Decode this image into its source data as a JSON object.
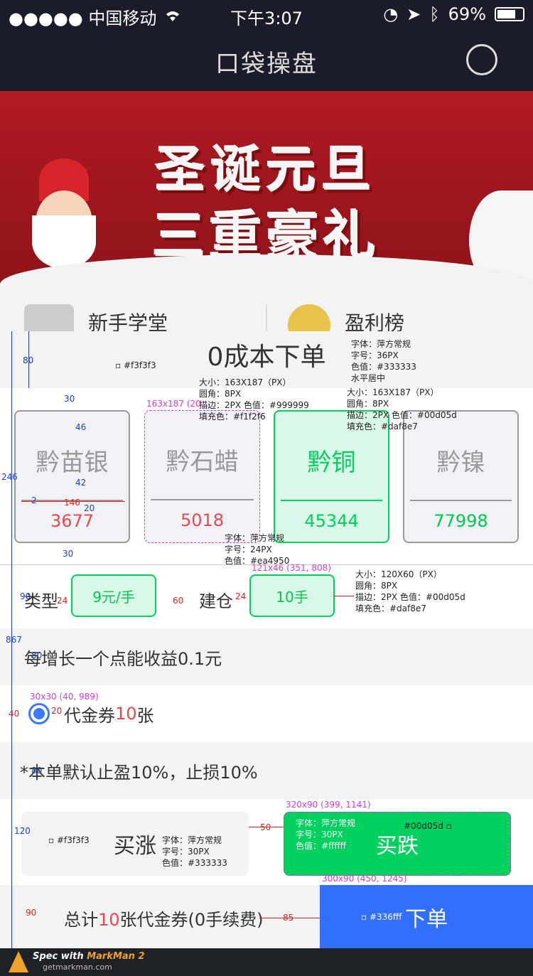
{
  "status_bar": {
    "carrier": "●●●●● 中国移动",
    "time": "下午3:07",
    "battery": "69%"
  },
  "nav": {
    "title": "口袋操盘"
  },
  "banner": {
    "line1": "圣诞元旦",
    "line2": "三重豪礼"
  },
  "quick_links": [
    {
      "label": "新手学堂"
    },
    {
      "label": "盈利榜"
    }
  ],
  "section_title": "0成本下单",
  "products": [
    {
      "name": "黔苗银",
      "price": "3677"
    },
    {
      "name": "黔石蜡",
      "price": "5018"
    },
    {
      "name": "黔铜",
      "price": "45344"
    },
    {
      "name": "黔镍",
      "price": "77998"
    }
  ],
  "type_row": {
    "type_label": "类型",
    "type_value": "9元/手",
    "build_label": "建仓",
    "build_value": "10手"
  },
  "gain_text": "每增长一个点能收益0.1元",
  "voucher": {
    "prefix": "代金券",
    "count": "10",
    "suffix": "张"
  },
  "stop_text": "*本单默认止盈10%，止损10%",
  "buttons": {
    "up": "买涨",
    "down": "买跌",
    "order": "下单"
  },
  "total": {
    "prefix": "总计",
    "count": "10",
    "suffix": "张代金券(0手续费)"
  },
  "annotations": {
    "bg_f3": "#f3f3f3",
    "title_spec": [
      "字体：萍方常规",
      "字号：36PX",
      "色值：#333333",
      "水平居中"
    ],
    "card_spec": [
      "大小：163X187（PX）",
      "圆角：8PX",
      "描边：2PX 色值：#999999",
      "填充色：#f1f2f6"
    ],
    "card_active_spec": [
      "大小：163X187（PX）",
      "圆角：8PX",
      "描边：2PX 色值：#00d05d",
      "填充色：#daf8e7"
    ],
    "card_dim": "163x187 (20…",
    "price_spec": [
      "字体：萍方常规",
      "字号：24PX",
      "色值：#ea4950"
    ],
    "pill_dim": "121x46 (351, 808)",
    "pill_spec": [
      "大小：120X60（PX）",
      "圆角：8PX",
      "描边：2PX 色值：#00d05d",
      "填充色：#daf8e7"
    ],
    "radio_dim": "30x30 (40, 989)",
    "up_spec": [
      "字体：萍方常规",
      "字号：30PX",
      "色值：#333333"
    ],
    "down_dim": "320x90 (399, 1141)",
    "down_spec": [
      "字体：萍方常规",
      "字号：30PX",
      "色值：#ffffff"
    ],
    "down_color": "#00d05d",
    "order_dim": "300x90 (450, 1245)",
    "order_color": "#336fff",
    "dims": {
      "a80": "80",
      "a30": "30",
      "a46": "46",
      "a42": "42",
      "a146": "146",
      "a20": "20",
      "a2": "2",
      "a246": "246",
      "a867": "867",
      "a90": "90",
      "a24": "24",
      "a60": "60",
      "a120": "120",
      "a50": "50",
      "a85": "85",
      "a40": "40"
    }
  },
  "footer": {
    "spec": "Spec with",
    "brand": "MarkMan 2",
    "url": "getmarkman.com"
  }
}
